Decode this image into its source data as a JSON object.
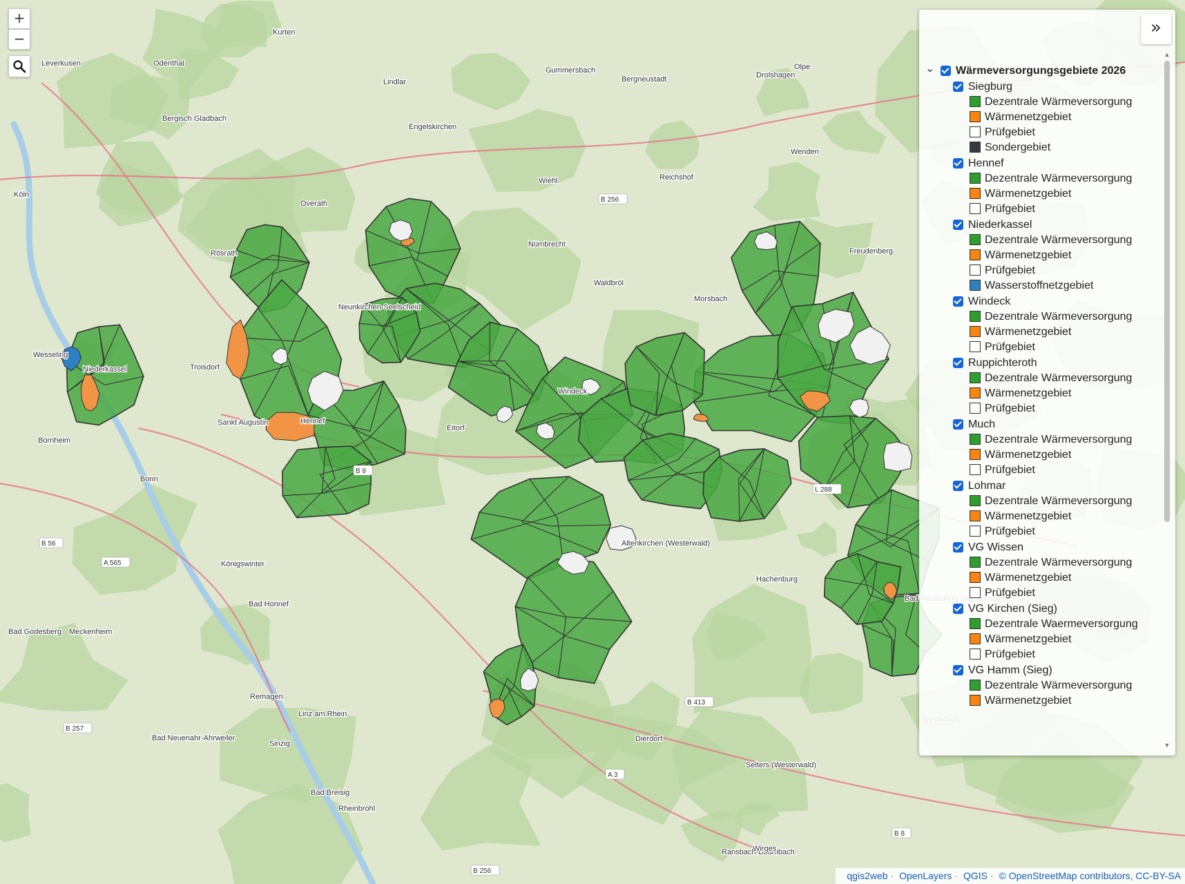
{
  "map": {
    "colors": {
      "base": "#dfe8cf",
      "forest": "#b9d5a0",
      "dezentral": "#4aa843",
      "waermenetz": "#f29446",
      "pruef": "#f1f1f1",
      "sonder": "#343a40",
      "wasserstoff": "#2f7fc1",
      "road": "#e6738a",
      "river": "#a8cde6",
      "boundary": "#333333"
    },
    "places": [
      "Kurten",
      "Leverkusen",
      "Odenthal",
      "Gummersbach",
      "Bergneustadt",
      "Drolshagen",
      "Olpe",
      "Lindlar",
      "Bergisch Gladbach",
      "Engelskirchen",
      "Wenden",
      "Köln",
      "Wiehl",
      "Reichshof",
      "Overath",
      "Nümbrecht",
      "Freudenberg",
      "Rösrath",
      "Waldbröl",
      "Morsbach",
      "Neunkirchen-Seelscheid",
      "Wesseling",
      "Niederkassel",
      "Troisdorf",
      "Sankt Augustin",
      "Hennef",
      "Eitorf",
      "Windeck",
      "Bornheim",
      "Bonn",
      "Königswinter",
      "Bad Honnef",
      "Meckenheim",
      "Remagen",
      "Linz am Rhein",
      "Hachenburg",
      "Dierdorf",
      "Selters (Westerwald)",
      "Bad Neuenahr-Ahrweiler",
      "Sinzig",
      "Bad Breisig",
      "Rheinbrohl",
      "Ransbach-Baumbach",
      "Wirges",
      "Westerburg",
      "Bad Marienberg (Westerwald)",
      "Altenkirchen (Westerwald)",
      "Bad Godesberg"
    ],
    "road_labels": [
      "B 56",
      "B 256",
      "A 565",
      "B 8",
      "B 413",
      "A 3",
      "B 257",
      "B 256",
      "B 8",
      "L 288"
    ]
  },
  "controls": {
    "zoom_in": "+",
    "zoom_out": "−",
    "search_icon": "search-icon",
    "collapse": "»"
  },
  "layer_tree": {
    "root": "Wärmeversorgungsgebiete 2026",
    "groups": [
      {
        "name": "Siegburg",
        "items": [
          {
            "label": "Dezentrale Wärmeversorgung",
            "color": "#2e9e2e"
          },
          {
            "label": "Wärmenetzgebiet",
            "color": "#f7850f"
          },
          {
            "label": "Prüfgebiet",
            "color": "#ffffff"
          },
          {
            "label": "Sondergebiet",
            "color": "#343a40"
          }
        ]
      },
      {
        "name": "Hennef",
        "items": [
          {
            "label": "Dezentrale Wärmeversorgung",
            "color": "#2e9e2e"
          },
          {
            "label": "Wärmenetzgebiet",
            "color": "#f7850f"
          },
          {
            "label": "Prüfgebiet",
            "color": "#ffffff"
          }
        ]
      },
      {
        "name": "Niederkassel",
        "items": [
          {
            "label": "Dezentrale Wärmeversorgung",
            "color": "#2e9e2e"
          },
          {
            "label": "Wärmenetzgebiet",
            "color": "#f7850f"
          },
          {
            "label": "Prüfgebiet",
            "color": "#ffffff"
          },
          {
            "label": "Wasserstoffnetzgebiet",
            "color": "#2f7fc1"
          }
        ]
      },
      {
        "name": "Windeck",
        "items": [
          {
            "label": "Dezentrale Wärmeversorgung",
            "color": "#2e9e2e"
          },
          {
            "label": "Wärmenetzgebiet",
            "color": "#f7850f"
          },
          {
            "label": "Prüfgebiet",
            "color": "#ffffff"
          }
        ]
      },
      {
        "name": "Ruppichteroth",
        "items": [
          {
            "label": "Dezentrale Wärmeversorgung",
            "color": "#2e9e2e"
          },
          {
            "label": "Wärmenetzgebiet",
            "color": "#f7850f"
          },
          {
            "label": "Prüfgebiet",
            "color": "#ffffff"
          }
        ]
      },
      {
        "name": "Much",
        "items": [
          {
            "label": "Dezentrale Wärmeversorgung",
            "color": "#2e9e2e"
          },
          {
            "label": "Wärmenetzgebiet",
            "color": "#f7850f"
          },
          {
            "label": "Prüfgebiet",
            "color": "#ffffff"
          }
        ]
      },
      {
        "name": "Lohmar",
        "items": [
          {
            "label": "Dezentrale Wärmeversorgung",
            "color": "#2e9e2e"
          },
          {
            "label": "Wärmenetzgebiet",
            "color": "#f7850f"
          },
          {
            "label": "Prüfgebiet",
            "color": "#ffffff"
          }
        ]
      },
      {
        "name": "VG Wissen",
        "items": [
          {
            "label": "Dezentrale Wärmeversorgung",
            "color": "#2e9e2e"
          },
          {
            "label": "Wärmenetzgebiet",
            "color": "#f7850f"
          },
          {
            "label": "Prüfgebiet",
            "color": "#ffffff"
          }
        ]
      },
      {
        "name": "VG Kirchen (Sieg)",
        "items": [
          {
            "label": "Dezentrale Waermeversorgung",
            "color": "#2e9e2e"
          },
          {
            "label": "Wärmenetzgebiet",
            "color": "#f7850f"
          },
          {
            "label": "Prüfgebiet",
            "color": "#ffffff"
          }
        ]
      },
      {
        "name": "VG Hamm (Sieg)",
        "items": [
          {
            "label": "Dezentrale Wärmeversorgung",
            "color": "#2e9e2e"
          },
          {
            "label": "Wärmenetzgebiet",
            "color": "#f7850f"
          }
        ]
      }
    ]
  },
  "attribution": {
    "qgis2web": "qgis2web",
    "openlayers": "OpenLayers",
    "qgis": "QGIS",
    "osm": "© OpenStreetMap contributors, CC-BY-SA"
  }
}
